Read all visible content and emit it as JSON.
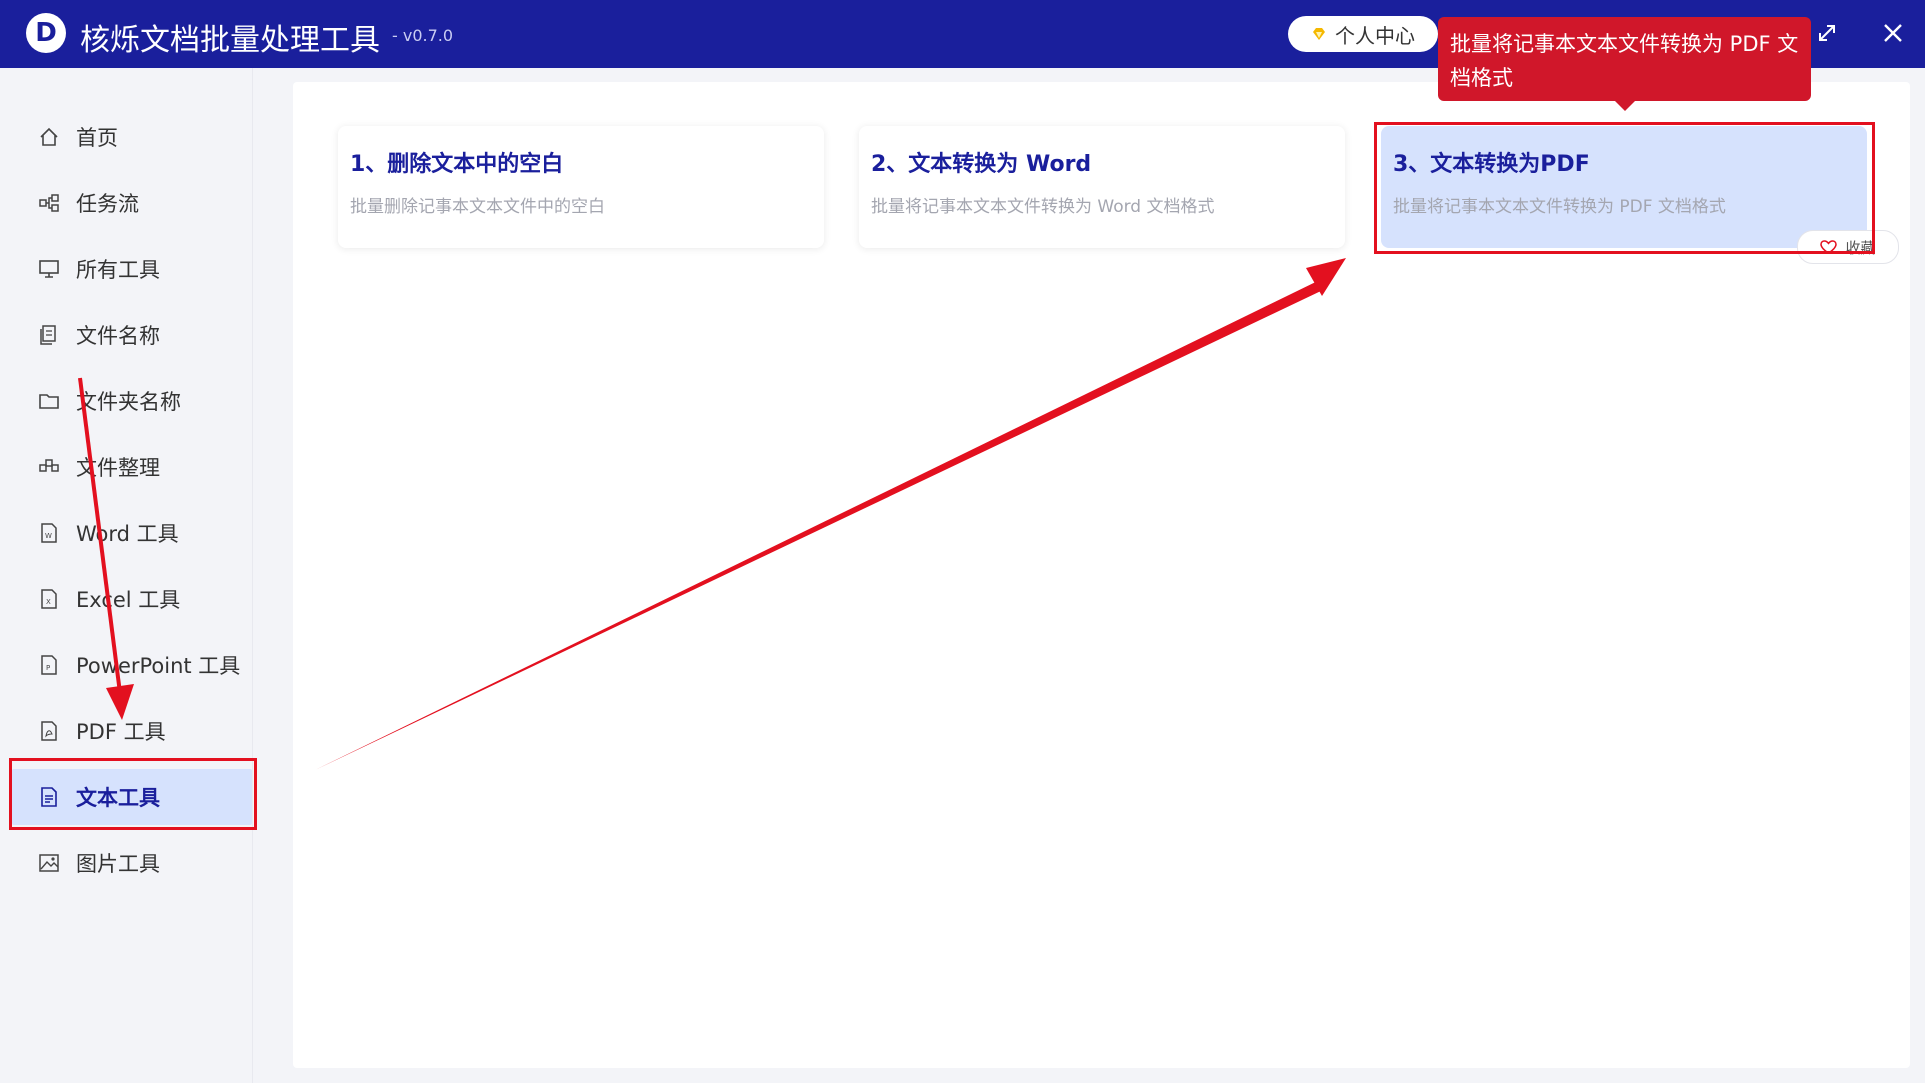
{
  "app": {
    "logo_letter": "D",
    "title": "核烁文档批量处理工具",
    "version": "- v0.7.0",
    "user_center_label": "个人中心"
  },
  "sidebar": {
    "items": [
      {
        "label": "首页",
        "icon": "home-icon",
        "active": false
      },
      {
        "label": "任务流",
        "icon": "workflow-icon",
        "active": false
      },
      {
        "label": "所有工具",
        "icon": "monitor-icon",
        "active": false
      },
      {
        "label": "文件名称",
        "icon": "files-icon",
        "active": false
      },
      {
        "label": "文件夹名称",
        "icon": "folder-icon",
        "active": false
      },
      {
        "label": "文件整理",
        "icon": "organize-icon",
        "active": false
      },
      {
        "label": "Word 工具",
        "icon": "word-file-icon",
        "active": false
      },
      {
        "label": "Excel 工具",
        "icon": "excel-file-icon",
        "active": false
      },
      {
        "label": "PowerPoint 工具",
        "icon": "powerpoint-file-icon",
        "active": false
      },
      {
        "label": "PDF 工具",
        "icon": "pdf-file-icon",
        "active": false
      },
      {
        "label": "文本工具",
        "icon": "text-file-icon",
        "active": true
      },
      {
        "label": "图片工具",
        "icon": "image-icon",
        "active": false
      }
    ]
  },
  "cards": [
    {
      "title": "1、删除文本中的空白",
      "desc": "批量删除记事本文本文件中的空白",
      "selected": false
    },
    {
      "title": "2、文本转换为 Word",
      "desc": "批量将记事本文本文件转换为 Word 文档格式",
      "selected": false
    },
    {
      "title": "3、文本转换为PDF",
      "desc": "批量将记事本文本文件转换为 PDF 文档格式",
      "selected": true
    }
  ],
  "favorite_label": "收藏",
  "tooltip": {
    "text": "批量将记事本文本文件转换为 PDF 文档格式"
  },
  "colors": {
    "brand": "#1a1f9c",
    "highlight": "#d6e2fd",
    "annotation_red": "#e3101f",
    "tooltip_red": "#d0172a"
  }
}
